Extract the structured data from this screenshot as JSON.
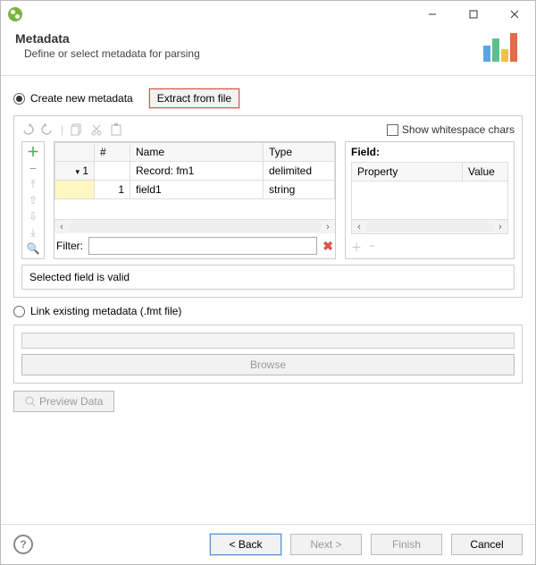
{
  "header": {
    "title": "Metadata",
    "subtitle": "Define or select metadata for parsing"
  },
  "options": {
    "create_label": "Create new metadata",
    "extract_label": "Extract from file",
    "link_label": "Link existing metadata (.fmt file)",
    "selected": "create"
  },
  "toolbar": {
    "show_ws_label": "Show whitespace chars",
    "show_ws_checked": false
  },
  "table": {
    "columns": {
      "num": "#",
      "name": "Name",
      "type": "Type"
    },
    "rows": [
      {
        "expand": true,
        "num": "1",
        "name": "Record: fm1",
        "type": "delimited"
      },
      {
        "expand": false,
        "num": "1",
        "name": "field1",
        "type": "string",
        "selected": true
      }
    ]
  },
  "field_panel": {
    "title": "Field:",
    "columns": {
      "prop": "Property",
      "val": "Value"
    }
  },
  "filter": {
    "label": "Filter:",
    "value": ""
  },
  "status": {
    "text": "Selected field is valid"
  },
  "link": {
    "path": "",
    "browse_label": "Browse"
  },
  "preview": {
    "label": "Preview Data"
  },
  "footer": {
    "back": "< Back",
    "next": "Next >",
    "finish": "Finish",
    "cancel": "Cancel"
  }
}
